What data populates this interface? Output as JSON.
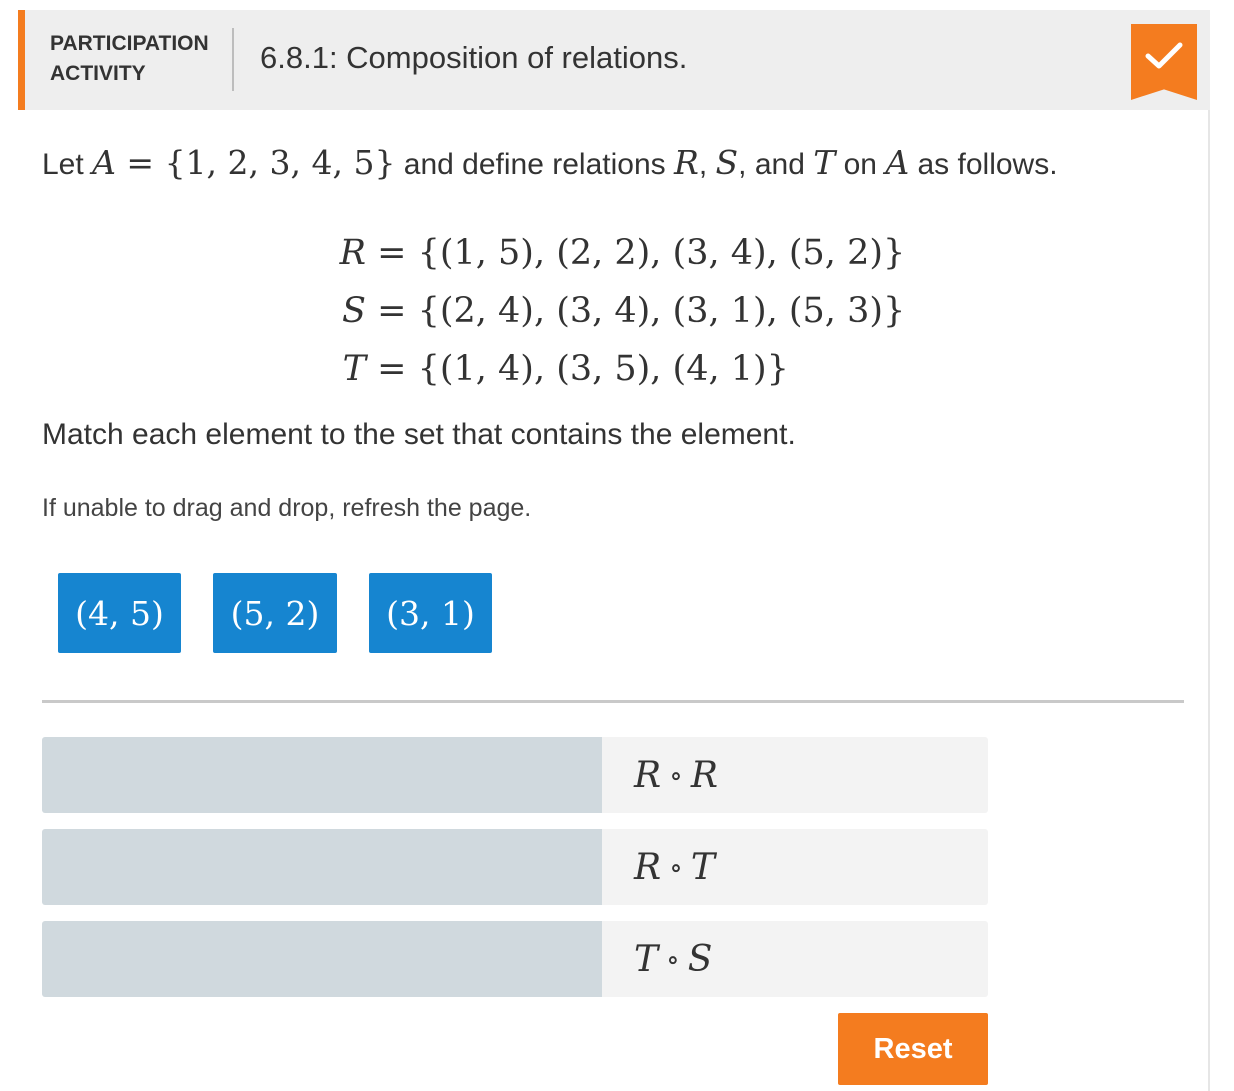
{
  "header": {
    "activity_type_line1": "PARTICIPATION",
    "activity_type_line2": "ACTIVITY",
    "title": "6.8.1: Composition of relations.",
    "status_icon": "checkmark-icon",
    "accent_color": "#f47c1f"
  },
  "intro": {
    "let_word": "Let",
    "set_name": "A",
    "equals": "=",
    "set_value": "{1, 2, 3, 4, 5}",
    "and_define": "and define relations",
    "r": "R",
    "comma1": ",",
    "s": "S",
    "comma_and": ", and",
    "t": "T",
    "on_word": "on",
    "set_name2": "A",
    "as_follows": "as follows."
  },
  "relations": [
    {
      "name": "R",
      "value": "{(1, 5), (2, 2), (3, 4), (5, 2)}"
    },
    {
      "name": "S",
      "value": "{(2, 4), (3, 4), (3, 1), (5, 3)}"
    },
    {
      "name": "T",
      "value": "{(1, 4), (3, 5), (4, 1)}"
    }
  ],
  "instructions": "Match each element to the set that contains the element.",
  "hint": "If unable to drag and drop, refresh the page.",
  "tiles": [
    {
      "label": "(4, 5)"
    },
    {
      "label": "(5, 2)"
    },
    {
      "label": "(3, 1)"
    }
  ],
  "tile_color": "#1685d0",
  "rows": [
    {
      "left": "R",
      "op": "∘",
      "right": "R"
    },
    {
      "left": "R",
      "op": "∘",
      "right": "T"
    },
    {
      "left": "T",
      "op": "∘",
      "right": "S"
    }
  ],
  "reset_label": "Reset"
}
